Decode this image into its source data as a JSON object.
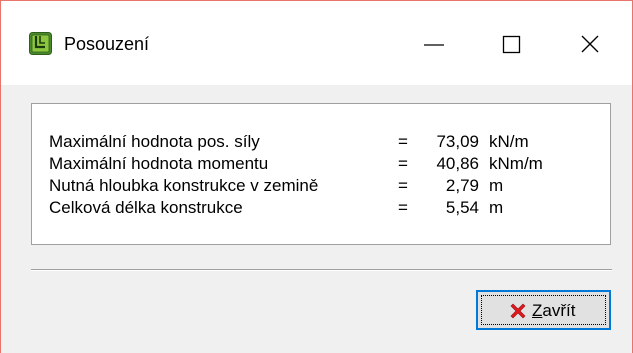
{
  "window": {
    "title": "Posouzení",
    "accent_border_color": "#e8746b",
    "controls": [
      "minimize-icon",
      "maximize-icon",
      "close-icon"
    ]
  },
  "results": [
    {
      "label": "Maximální hodnota pos. síly",
      "eq": "=",
      "value": "73,09",
      "unit": "kN/m"
    },
    {
      "label": "Maximální hodnota momentu",
      "eq": "=",
      "value": "40,86",
      "unit": "kNm/m"
    },
    {
      "label": "Nutná hloubka konstrukce v zemině",
      "eq": "=",
      "value": "2,79",
      "unit": "m"
    },
    {
      "label": "Celková délka konstrukce",
      "eq": "=",
      "value": "5,54",
      "unit": "m"
    }
  ],
  "close_button": {
    "mnemonic": "Z",
    "label_rest": "avřít",
    "icon": "red-x-icon",
    "focus_color": "#0078d7"
  }
}
